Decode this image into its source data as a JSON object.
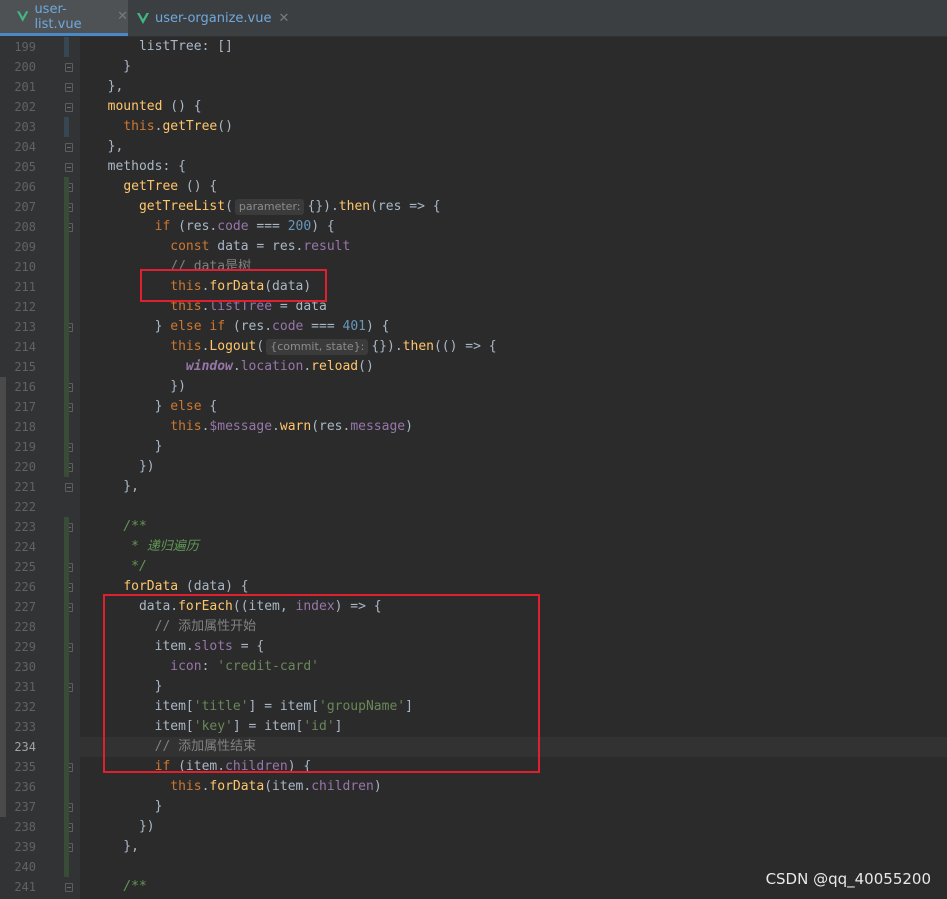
{
  "tabs": [
    {
      "label": "user-list.vue",
      "icon": "vue-icon",
      "active": true
    },
    {
      "label": "user-organize.vue",
      "icon": "vue-icon",
      "active": false
    }
  ],
  "colors": {
    "keyword": "#cc7832",
    "function": "#ffc66d",
    "property": "#9876aa",
    "string": "#6a8759",
    "number": "#6897bb",
    "comment": "#808080",
    "doc_comment": "#629755",
    "highlight_box": "#e0202e"
  },
  "current_line": 234,
  "lines": [
    {
      "n": "199",
      "t": [
        [
          "      listTree: []",
          ""
        ]
      ]
    },
    {
      "n": "200",
      "t": [
        [
          "    }",
          ""
        ]
      ]
    },
    {
      "n": "201",
      "t": [
        [
          "  },",
          ""
        ]
      ]
    },
    {
      "n": "202",
      "t": [
        [
          "  ",
          ""
        ],
        [
          "mounted",
          "fn"
        ],
        [
          " () {",
          ""
        ]
      ]
    },
    {
      "n": "203",
      "t": [
        [
          "    ",
          ""
        ],
        [
          "this",
          "kw"
        ],
        [
          ".",
          ""
        ],
        [
          "getTree",
          "fn"
        ],
        [
          "()",
          ""
        ]
      ]
    },
    {
      "n": "204",
      "t": [
        [
          "  },",
          ""
        ]
      ]
    },
    {
      "n": "205",
      "t": [
        [
          "  methods: {",
          ""
        ]
      ]
    },
    {
      "n": "206",
      "t": [
        [
          "    ",
          ""
        ],
        [
          "getTree",
          "fn"
        ],
        [
          " () {",
          ""
        ]
      ]
    },
    {
      "n": "207",
      "t": [
        [
          "      ",
          ""
        ],
        [
          "getTreeList",
          "fn"
        ],
        [
          "(",
          ""
        ],
        [
          "parameter:",
          "hint"
        ],
        [
          "{}).",
          ""
        ],
        [
          "then",
          "fn"
        ],
        [
          "(res => {",
          ""
        ]
      ]
    },
    {
      "n": "208",
      "t": [
        [
          "        ",
          ""
        ],
        [
          "if",
          "kw"
        ],
        [
          " (res.",
          ""
        ],
        [
          "code",
          "prop"
        ],
        [
          " === ",
          ""
        ],
        [
          "200",
          "num"
        ],
        [
          ") {",
          ""
        ]
      ]
    },
    {
      "n": "209",
      "t": [
        [
          "          ",
          ""
        ],
        [
          "const",
          "kw"
        ],
        [
          " data = res.",
          ""
        ],
        [
          "result",
          "prop"
        ]
      ]
    },
    {
      "n": "210",
      "t": [
        [
          "          ",
          ""
        ],
        [
          "// data是树",
          "cmt"
        ]
      ]
    },
    {
      "n": "211",
      "t": [
        [
          "          ",
          ""
        ],
        [
          "this",
          "kw"
        ],
        [
          ".",
          ""
        ],
        [
          "forData",
          "fn"
        ],
        [
          "(data)",
          ""
        ]
      ]
    },
    {
      "n": "212",
      "t": [
        [
          "          ",
          ""
        ],
        [
          "this",
          "kw"
        ],
        [
          ".",
          ""
        ],
        [
          "listTree",
          "prop"
        ],
        [
          " = data",
          ""
        ]
      ]
    },
    {
      "n": "213",
      "t": [
        [
          "        } ",
          ""
        ],
        [
          "else if",
          "kw"
        ],
        [
          " (res.",
          ""
        ],
        [
          "code",
          "prop"
        ],
        [
          " === ",
          ""
        ],
        [
          "401",
          "num"
        ],
        [
          ") {",
          ""
        ]
      ]
    },
    {
      "n": "214",
      "t": [
        [
          "          ",
          ""
        ],
        [
          "this",
          "kw"
        ],
        [
          ".",
          ""
        ],
        [
          "Logout",
          "fn"
        ],
        [
          "(",
          ""
        ],
        [
          "{commit, state}:",
          "hint"
        ],
        [
          "{}).",
          ""
        ],
        [
          "then",
          "fn"
        ],
        [
          "(() => {",
          ""
        ]
      ]
    },
    {
      "n": "215",
      "t": [
        [
          "            ",
          ""
        ],
        [
          "window",
          "glob"
        ],
        [
          ".",
          ""
        ],
        [
          "location",
          "prop"
        ],
        [
          ".",
          ""
        ],
        [
          "reload",
          "fn"
        ],
        [
          "()",
          ""
        ]
      ]
    },
    {
      "n": "216",
      "t": [
        [
          "          })",
          ""
        ]
      ]
    },
    {
      "n": "217",
      "t": [
        [
          "        } ",
          ""
        ],
        [
          "else",
          "kw"
        ],
        [
          " {",
          ""
        ]
      ]
    },
    {
      "n": "218",
      "t": [
        [
          "          ",
          ""
        ],
        [
          "this",
          "kw"
        ],
        [
          ".",
          ""
        ],
        [
          "$message",
          "prop"
        ],
        [
          ".",
          ""
        ],
        [
          "warn",
          "fn"
        ],
        [
          "(res.",
          ""
        ],
        [
          "message",
          "prop"
        ],
        [
          ")",
          ""
        ]
      ]
    },
    {
      "n": "219",
      "t": [
        [
          "        }",
          ""
        ]
      ]
    },
    {
      "n": "220",
      "t": [
        [
          "      })",
          ""
        ]
      ]
    },
    {
      "n": "221",
      "t": [
        [
          "    },",
          ""
        ]
      ]
    },
    {
      "n": "222",
      "t": []
    },
    {
      "n": "223",
      "t": [
        [
          "    ",
          ""
        ],
        [
          "/**",
          "doc"
        ]
      ]
    },
    {
      "n": "224",
      "t": [
        [
          "     ",
          ""
        ],
        [
          "* 递归遍历",
          "doc"
        ]
      ]
    },
    {
      "n": "225",
      "t": [
        [
          "     ",
          ""
        ],
        [
          "*/",
          "doc"
        ]
      ]
    },
    {
      "n": "226",
      "t": [
        [
          "    ",
          ""
        ],
        [
          "forData",
          "fn"
        ],
        [
          " (data) {",
          ""
        ]
      ]
    },
    {
      "n": "227",
      "t": [
        [
          "      data.",
          ""
        ],
        [
          "forEach",
          "fn"
        ],
        [
          "((item, ",
          ""
        ],
        [
          "index",
          "prop"
        ],
        [
          ") => {",
          ""
        ]
      ]
    },
    {
      "n": "228",
      "t": [
        [
          "        ",
          ""
        ],
        [
          "// 添加属性开始",
          "cmt"
        ]
      ]
    },
    {
      "n": "229",
      "t": [
        [
          "        item.",
          ""
        ],
        [
          "slots",
          "prop"
        ],
        [
          " = {",
          ""
        ]
      ]
    },
    {
      "n": "230",
      "t": [
        [
          "          ",
          ""
        ],
        [
          "icon",
          "prop"
        ],
        [
          ": ",
          ""
        ],
        [
          "'credit-card'",
          "str"
        ]
      ]
    },
    {
      "n": "231",
      "t": [
        [
          "        }",
          ""
        ]
      ]
    },
    {
      "n": "232",
      "t": [
        [
          "        item[",
          ""
        ],
        [
          "'title'",
          "str"
        ],
        [
          "] = item[",
          ""
        ],
        [
          "'groupName'",
          "str"
        ],
        [
          "]",
          ""
        ]
      ]
    },
    {
      "n": "233",
      "t": [
        [
          "        item[",
          ""
        ],
        [
          "'key'",
          "str"
        ],
        [
          "] = item[",
          ""
        ],
        [
          "'id'",
          "str"
        ],
        [
          "]",
          ""
        ]
      ]
    },
    {
      "n": "234",
      "t": [
        [
          "        ",
          ""
        ],
        [
          "// 添加属性结束",
          "cmt"
        ]
      ]
    },
    {
      "n": "235",
      "t": [
        [
          "        ",
          ""
        ],
        [
          "if",
          "kw"
        ],
        [
          " (item.",
          ""
        ],
        [
          "children",
          "prop"
        ],
        [
          ") {",
          ""
        ]
      ]
    },
    {
      "n": "236",
      "t": [
        [
          "          ",
          ""
        ],
        [
          "this",
          "kw"
        ],
        [
          ".",
          ""
        ],
        [
          "forData",
          "fn"
        ],
        [
          "(item.",
          ""
        ],
        [
          "children",
          "prop"
        ],
        [
          ")",
          ""
        ]
      ]
    },
    {
      "n": "237",
      "t": [
        [
          "        }",
          ""
        ]
      ]
    },
    {
      "n": "238",
      "t": [
        [
          "      })",
          ""
        ]
      ]
    },
    {
      "n": "239",
      "t": [
        [
          "    },",
          ""
        ]
      ]
    },
    {
      "n": "240",
      "t": []
    },
    {
      "n": "241",
      "t": [
        [
          "    ",
          ""
        ],
        [
          "/**",
          "doc"
        ]
      ]
    }
  ],
  "watermark": "CSDN @qq_40055200"
}
